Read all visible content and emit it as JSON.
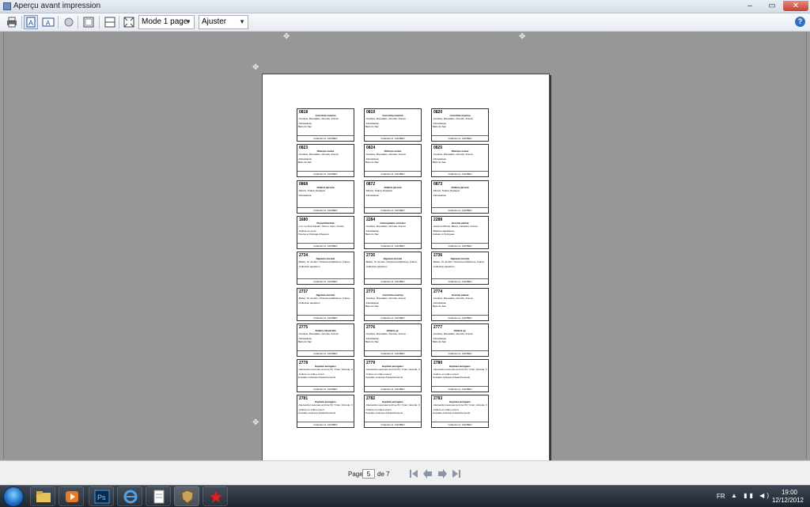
{
  "window": {
    "title": "Aperçu avant impression",
    "controls": {
      "minimize": "–",
      "maximize": "▭",
      "close": "✕"
    }
  },
  "toolbar": {
    "mode_select": "Mode 1 page",
    "zoom_select": "Ajuster",
    "help": "?"
  },
  "labels": [
    {
      "code": "0818",
      "name": "Cucurbita maxima&lt;&gt;",
      "loc": "-Cambes, Rivesaltes, Gironde, France",
      "l2": "-Floraisaison",
      "l3": "Bacs du Sac",
      "coll": "Collection A. CHOBEV"
    },
    {
      "code": "0819",
      "name": "Cucurbita maxima&lt;&gt;",
      "loc": "-Cambes, Rivesaltes, Gironde, France",
      "l2": "-Floraisaison",
      "l3": "Bacs du Sac",
      "coll": "Collection A. CHOBEV"
    },
    {
      "code": "0820",
      "name": "Cucurbita maxima&lt;&gt;",
      "loc": "-Cambes, Rivesaltes, Gironde, France",
      "l2": "-Floraisaison",
      "l3": "Bacs du Sac",
      "coll": "Collection A. CHOBEV"
    },
    {
      "code": "0823",
      "name": "Rhinops nudus",
      "loc": "-Cambes, Rivesaltes, Gironde, France",
      "l2": "-Floraisaison",
      "l3": "Bacs du Sac",
      "coll": "Collection A. CHOBEV"
    },
    {
      "code": "0824",
      "name": "Rhinops nudus",
      "loc": "-Cambes, Rivesaltes, Gironde, France",
      "l2": "-Floraisaison",
      "l3": "Bacs du Sac",
      "coll": "Collection A. CHOBEV"
    },
    {
      "code": "0825",
      "name": "Rhinops nudus",
      "loc": "-Cambes, Rivesaltes, Gironde, France",
      "l2": "-Floraisaison",
      "l3": "Bacs du Sac",
      "coll": "Collection A. CHOBEV"
    },
    {
      "code": "0868",
      "name": "Zelleria parvula",
      "loc": "-Murcia, Totana, Espagne",
      "l2": "-Floraisaison",
      "l3": "",
      "coll": "Collection A. CHOBEV"
    },
    {
      "code": "0872",
      "name": "Zelleria parvula",
      "loc": "-Murcia, Totana, Espagne",
      "l2": "-Floraisaison",
      "l3": "",
      "coll": "Collection A. CHOBEV"
    },
    {
      "code": "0873",
      "name": "Zelleria parvula",
      "loc": "-Murcia, Totana, Espagne",
      "l2": "-Floraisaison",
      "l3": "",
      "coll": "Collection A. CHOBEV"
    },
    {
      "code": "1680",
      "name": "Dryophthorinae",
      "loc": "-L.G. La Tour Gaudin, Oloron, Gers, France",
      "l2": "-Culture en serre",
      "l3": "Viveros et Ciénaga d'Agesca",
      "coll": "Collection A. CHOBEV"
    },
    {
      "code": "2284",
      "name": "Calocephalus sericeus",
      "loc": "-Cambes, Rivesaltes, Gironde, France",
      "l2": "-Floraisaison",
      "l3": "Bacs du Sac",
      "coll": "Collection A. CHOBEV"
    },
    {
      "code": "2288",
      "name": "Junonia juliana",
      "loc": "-Gaud du Rhône, Bessy, Calvados, France",
      "l2": "-Bassins aquatiques",
      "l3": "Calvaire à Syringues",
      "coll": "Collection A. CHOBEV"
    },
    {
      "code": "2734",
      "name": "Digrauta muralis",
      "loc": "-Belles, St. de Rec, Charentes-Maritimes, France",
      "l2": "-Collection aquarium",
      "l3": "",
      "coll": "Collection A. CHOBEV"
    },
    {
      "code": "2735",
      "name": "Digrauta muralis",
      "loc": "-Belles, St. de Rec, Charentes-Maritimes, France",
      "l2": "-Collection aquarium",
      "l3": "",
      "coll": "Collection A. CHOBEV"
    },
    {
      "code": "2736",
      "name": "Digrauta muralis",
      "loc": "-Belles, St. de Rec, Charentes-Maritimes, France",
      "l2": "-Collection aquarium",
      "l3": "",
      "coll": "Collection A. CHOBEV"
    },
    {
      "code": "2737",
      "name": "Digrauta muralis",
      "loc": "-Belles, St. de Rec, Charentes-Maritimes, France",
      "l2": "-Collection aquarium",
      "l3": "",
      "coll": "Collection A. CHOBEV"
    },
    {
      "code": "2773",
      "name": "Cucurbita maxima&lt;&gt;",
      "loc": "-Cambes, Rivesaltes, Gironde, France",
      "l2": "-Floraisaison",
      "l3": "Bacs du Sac",
      "coll": "Collection A. CHOBEV"
    },
    {
      "code": "2774",
      "name": "Junonia juliana",
      "loc": "-Cambes, Rivesaltes, Gironde, France",
      "l2": "-Floraisaison",
      "l3": "Bacs du Sac",
      "coll": "Collection A. CHOBEV"
    },
    {
      "code": "2775",
      "name": "Zelleria oleastrella",
      "loc": "-Cambes, Rivesaltes, Gironde, France",
      "l2": "-Floraisaison",
      "l3": "Bacs du Sac",
      "coll": "Collection A. CHOBEV"
    },
    {
      "code": "2776",
      "name": "Zelleria sp.",
      "loc": "-Cambes, Rivesaltes, Gironde, France",
      "l2": "-Floraisaison",
      "l3": "Bacs du Sac",
      "coll": "Collection A. CHOBEV"
    },
    {
      "code": "2777",
      "name": "Zelleria sp.",
      "loc": "-Cambes, Rivesaltes, Gironde, France",
      "l2": "-Floraisaison",
      "l3": "Bacs du Sac",
      "coll": "Collection A. CHOBEV"
    },
    {
      "code": "2778",
      "name": "Euphoia auriagens",
      "loc": "-Intersection avenues and rue 53, Yvrac, Gironde, France",
      "l2": "-Culture en milieu ouvert",
      "l3": "Cessaire caniveau d'asséchements",
      "coll": "Collection A. CHOBEV"
    },
    {
      "code": "2779",
      "name": "Euphoia auriagens",
      "loc": "-Intersection avenues and rue 53, Yvrac, Gironde, France",
      "l2": "-Culture en milieu ouvert",
      "l3": "Cessaire caniveau d'asséchements",
      "coll": "Collection A. CHOBEV"
    },
    {
      "code": "2780",
      "name": "Euphoia auriagens",
      "loc": "-Intersection avenues and rue 53, Yvrac, Gironde, France",
      "l2": "-Culture en milieu ouvert",
      "l3": "Cessaire caniveau d'asséchements",
      "coll": "Collection A. CHOBEV"
    },
    {
      "code": "2781",
      "name": "Euphoia auriagens",
      "loc": "-Intersection avenues and rue 53, Yvrac, Gironde, France",
      "l2": "-Culture en milieu ouvert",
      "l3": "Cessaire caniveau d'asséchements",
      "coll": "Collection A. CHOBEV"
    },
    {
      "code": "2782",
      "name": "Euphoia auriagens",
      "loc": "-Intersection avenues and rue 53, Yvrac, Gironde, France",
      "l2": "-Culture en milieu ouvert",
      "l3": "Cessaire caniveau d'asséchements",
      "coll": "Collection A. CHOBEV"
    },
    {
      "code": "2783",
      "name": "Euphoia auriagens",
      "loc": "-Intersection avenues and rue 53, Yvrac, Gironde, France",
      "l2": "-Culture en milieu ouvert",
      "l3": "Cessaire caniveau d'asséchements",
      "coll": "Collection A. CHOBEV"
    }
  ],
  "pager": {
    "page_label": "Page",
    "current_page": "5",
    "of_label": "de 7"
  },
  "taskbar": {
    "language": "FR",
    "tray": "▲ ▮▮ ◀)",
    "time": "19:00",
    "date": "12/12/2012"
  },
  "icons": [
    "print-icon",
    "one-page-icon",
    "two-page-icon",
    "zoom-icon",
    "fit-page-icon",
    "fit-width-icon",
    "full-page-icon",
    "help-icon",
    "first-page-icon",
    "prev-page-icon",
    "next-page-icon",
    "last-page-icon"
  ]
}
